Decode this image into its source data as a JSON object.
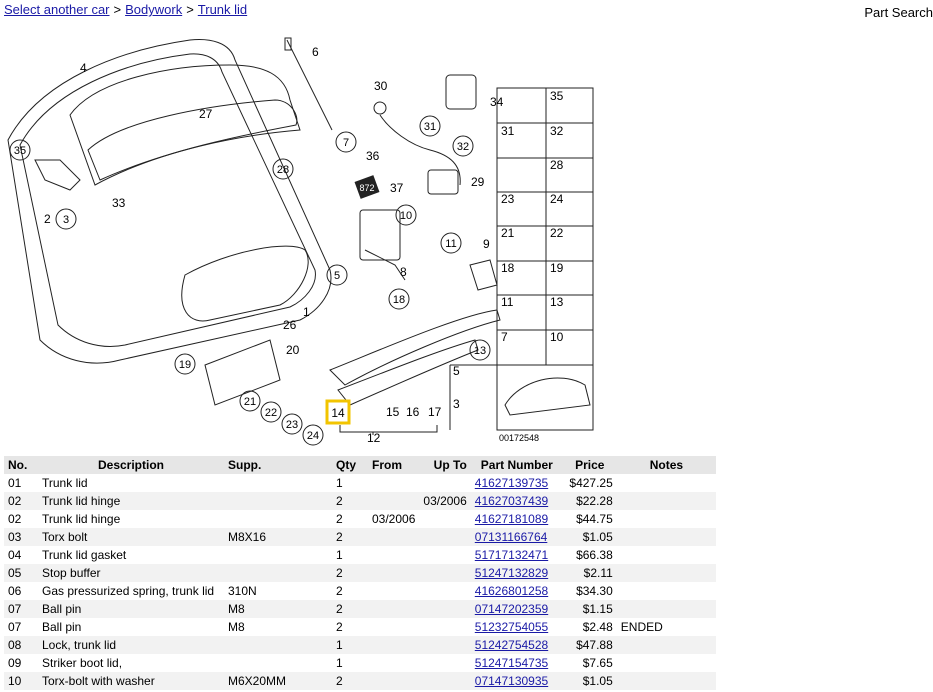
{
  "breadcrumb": {
    "links": [
      "Select another car",
      "Bodywork",
      "Trunk lid"
    ],
    "separator": ">"
  },
  "part_search_label": "Part Search",
  "diagram": {
    "callouts": [
      "1",
      "2",
      "3",
      "4",
      "5",
      "6",
      "7",
      "8",
      "9",
      "10",
      "11",
      "12",
      "13",
      "14",
      "15",
      "16",
      "17",
      "18",
      "19",
      "20",
      "21",
      "22",
      "23",
      "24",
      "25",
      "26",
      "27",
      "28",
      "29",
      "30",
      "31",
      "32",
      "33",
      "34",
      "35",
      "36",
      "37"
    ],
    "grid_labels": [
      "35",
      "31",
      "32",
      "28",
      "23",
      "24",
      "21",
      "22",
      "18",
      "19",
      "11",
      "13",
      "7",
      "10",
      "5",
      "3"
    ],
    "badge": "872",
    "image_code": "00172548",
    "highlight_color": "#f2c400"
  },
  "table": {
    "headers": [
      "No.",
      "Description",
      "Supp.",
      "Qty",
      "From",
      "Up To",
      "Part Number",
      "Price",
      "Notes"
    ],
    "rows": [
      {
        "no": "01",
        "desc": "Trunk lid",
        "supp": "",
        "qty": "1",
        "from": "",
        "upto": "",
        "part": "41627139735",
        "price": "$427.25",
        "notes": ""
      },
      {
        "no": "02",
        "desc": "Trunk lid hinge",
        "supp": "",
        "qty": "2",
        "from": "",
        "upto": "03/2006",
        "part": "41627037439",
        "price": "$22.28",
        "notes": ""
      },
      {
        "no": "02",
        "desc": "Trunk lid hinge",
        "supp": "",
        "qty": "2",
        "from": "03/2006",
        "upto": "",
        "part": "41627181089",
        "price": "$44.75",
        "notes": ""
      },
      {
        "no": "03",
        "desc": "Torx bolt",
        "supp": "M8X16",
        "qty": "2",
        "from": "",
        "upto": "",
        "part": "07131166764",
        "price": "$1.05",
        "notes": ""
      },
      {
        "no": "04",
        "desc": "Trunk lid gasket",
        "supp": "",
        "qty": "1",
        "from": "",
        "upto": "",
        "part": "51717132471",
        "price": "$66.38",
        "notes": ""
      },
      {
        "no": "05",
        "desc": "Stop buffer",
        "supp": "",
        "qty": "2",
        "from": "",
        "upto": "",
        "part": "51247132829",
        "price": "$2.11",
        "notes": ""
      },
      {
        "no": "06",
        "desc": "Gas pressurized spring, trunk lid",
        "supp": "310N",
        "qty": "2",
        "from": "",
        "upto": "",
        "part": "41626801258",
        "price": "$34.30",
        "notes": ""
      },
      {
        "no": "07",
        "desc": "Ball pin",
        "supp": "M8",
        "qty": "2",
        "from": "",
        "upto": "",
        "part": "07147202359",
        "price": "$1.15",
        "notes": ""
      },
      {
        "no": "07",
        "desc": "Ball pin",
        "supp": "M8",
        "qty": "2",
        "from": "",
        "upto": "",
        "part": "51232754055",
        "price": "$2.48",
        "notes": "ENDED"
      },
      {
        "no": "08",
        "desc": "Lock, trunk lid",
        "supp": "",
        "qty": "1",
        "from": "",
        "upto": "",
        "part": "51242754528",
        "price": "$47.88",
        "notes": ""
      },
      {
        "no": "09",
        "desc": "Striker boot lid,",
        "supp": "",
        "qty": "1",
        "from": "",
        "upto": "",
        "part": "51247154735",
        "price": "$7.65",
        "notes": ""
      },
      {
        "no": "10",
        "desc": "Torx-bolt with washer",
        "supp": "M6X20MM",
        "qty": "2",
        "from": "",
        "upto": "",
        "part": "07147130935",
        "price": "$1.05",
        "notes": ""
      }
    ]
  }
}
